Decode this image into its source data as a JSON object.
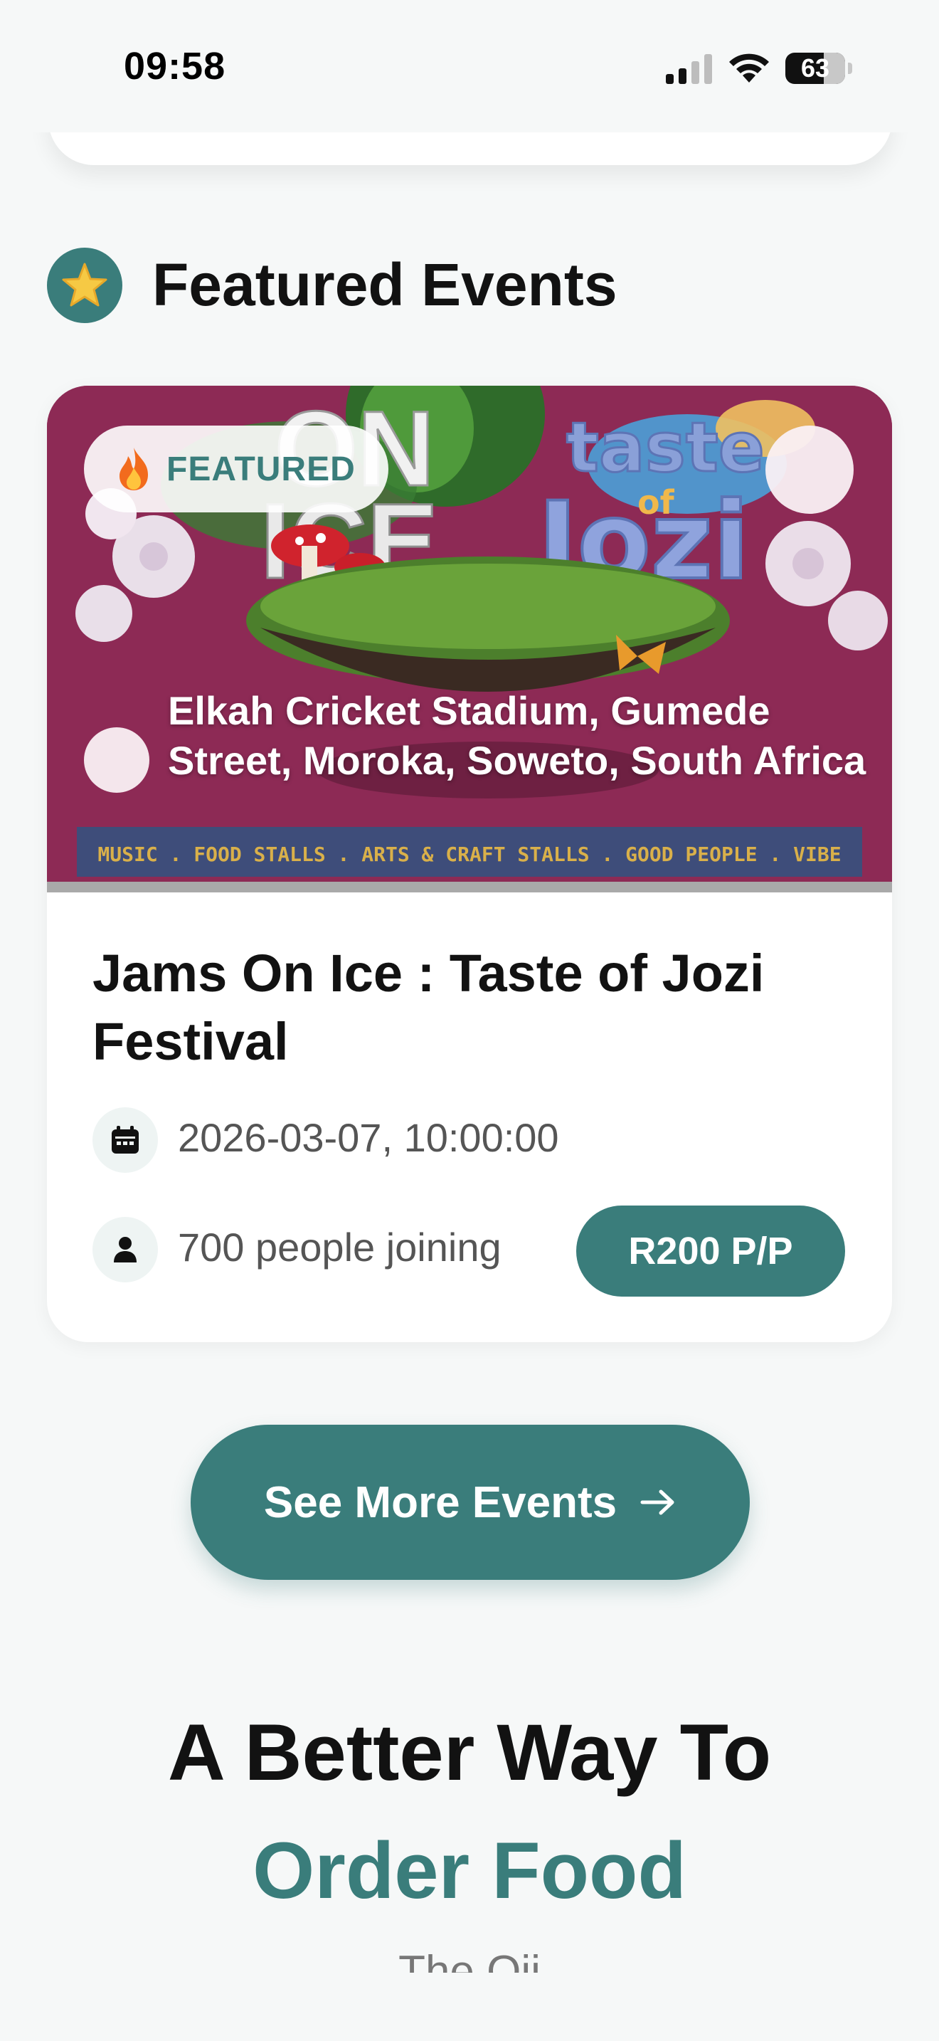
{
  "status_bar": {
    "time": "09:58",
    "battery": "63",
    "icons": [
      "signal-icon",
      "wifi-icon",
      "battery-icon"
    ]
  },
  "featured_section": {
    "title": "Featured Events",
    "icon": "star-icon",
    "accent_color": "#3a7d7b"
  },
  "event": {
    "badge_label": "FEATURED",
    "badge_icon": "fire-icon",
    "location": "Elkah Cricket Stadium, Gumede Street, Moroka, Soweto, South Africa",
    "title": "Jams On Ice : Taste of Jozi Festival",
    "datetime": "2026-03-07, 10:00:00",
    "attendees": "700 people joining",
    "price": "R200 P/P",
    "poster_lettering": [
      "ON",
      "ICE",
      "taste",
      "of",
      "Jozi"
    ],
    "poster_banner": "MUSIC . FOOD STALLS . ARTS & CRAFT STALLS . GOOD PEOPLE . VIBE"
  },
  "see_more": {
    "label": "See More Events",
    "icon": "arrow-right-icon"
  },
  "promo": {
    "heading_line1": "A Better Way To",
    "heading_line2": "Order Food",
    "cut_subtext": "The Oji"
  }
}
